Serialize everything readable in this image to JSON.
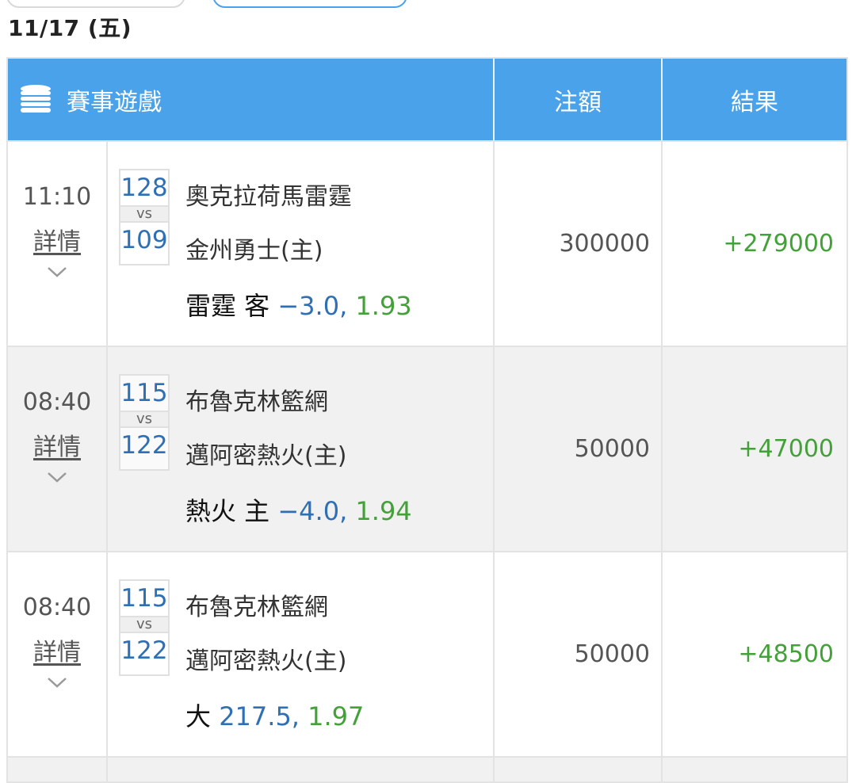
{
  "date_header": "11/17 (五)",
  "table": {
    "header": {
      "game": "賽事遊戲",
      "bet": "注額",
      "result": "結果",
      "icon": "coins-stack-icon"
    },
    "rows": [
      {
        "time": "11:10",
        "detail": "詳情",
        "away_score": "128",
        "vs": "vs",
        "home_score": "109",
        "away_team": "奧克拉荷馬雷霆",
        "home_team": "金州勇士(主)",
        "pick_team": "雷霆 客",
        "pick_line": "−3.0,",
        "pick_odds": "1.93",
        "bet": "300000",
        "result": "+279000"
      },
      {
        "time": "08:40",
        "detail": "詳情",
        "away_score": "115",
        "vs": "vs",
        "home_score": "122",
        "away_team": "布魯克林籃網",
        "home_team": "邁阿密熱火(主)",
        "pick_team": "熱火 主",
        "pick_line": "−4.0,",
        "pick_odds": "1.94",
        "bet": "50000",
        "result": "+47000"
      },
      {
        "time": "08:40",
        "detail": "詳情",
        "away_score": "115",
        "vs": "vs",
        "home_score": "122",
        "away_team": "布魯克林籃網",
        "home_team": "邁阿密熱火(主)",
        "pick_team": "大",
        "pick_line": "217.5,",
        "pick_odds": "1.97",
        "bet": "50000",
        "result": "+48500"
      }
    ]
  },
  "colors": {
    "header_bg": "#4aa3ea",
    "score_blue": "#2f6fb3",
    "win_green": "#44a13a"
  }
}
